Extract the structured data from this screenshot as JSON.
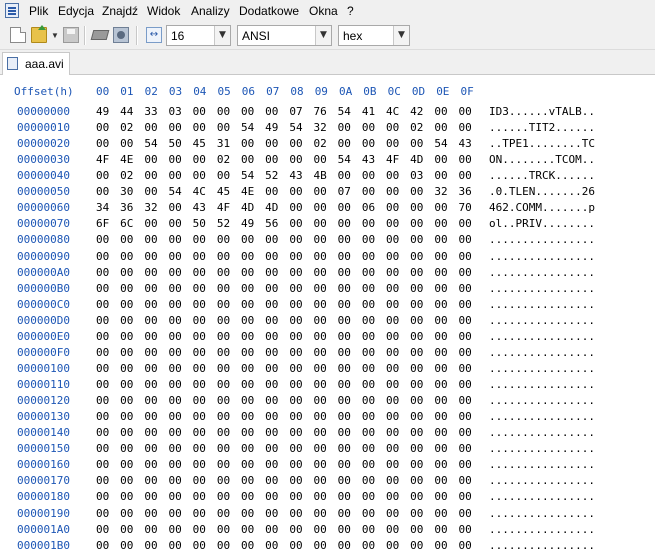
{
  "menubar": {
    "items": [
      "Plik",
      "Edycja",
      "Znajdź",
      "Widok",
      "Analizy",
      "Dodatkowe",
      "Okna",
      "?"
    ]
  },
  "toolbar": {
    "bytes_per_row": "16",
    "charset": "ANSI",
    "display_mode": "hex",
    "icons": [
      "new-file-icon",
      "open-file-icon",
      "save-icon",
      "ram-icon",
      "disk-icon",
      "width-icon"
    ]
  },
  "tab": {
    "label": "aaa.avi"
  },
  "hexview": {
    "offset_header": "Offset(h)",
    "column_headers": [
      "00",
      "01",
      "02",
      "03",
      "04",
      "05",
      "06",
      "07",
      "08",
      "09",
      "0A",
      "0B",
      "0C",
      "0D",
      "0E",
      "0F"
    ],
    "rows": [
      {
        "offset": "00000000",
        "bytes": "49 44 33 03 00 00 00 00 07 76 54 41 4C 42 00 00",
        "ascii": "ID3......vTALB.."
      },
      {
        "offset": "00000010",
        "bytes": "00 02 00 00 00 00 54 49 54 32 00 00 00 02 00 00",
        "ascii": "......TIT2......"
      },
      {
        "offset": "00000020",
        "bytes": "00 00 54 50 45 31 00 00 00 02 00 00 00 00 54 43",
        "ascii": "..TPE1........TC"
      },
      {
        "offset": "00000030",
        "bytes": "4F 4E 00 00 00 02 00 00 00 00 54 43 4F 4D 00 00",
        "ascii": "ON........TCOM.."
      },
      {
        "offset": "00000040",
        "bytes": "00 02 00 00 00 00 54 52 43 4B 00 00 00 03 00 00",
        "ascii": "......TRCK......"
      },
      {
        "offset": "00000050",
        "bytes": "00 30 00 54 4C 45 4E 00 00 00 07 00 00 00 32 36",
        "ascii": ".0.TLEN.......26"
      },
      {
        "offset": "00000060",
        "bytes": "34 36 32 00 43 4F 4D 4D 00 00 00 06 00 00 00 70",
        "ascii": "462.COMM.......p"
      },
      {
        "offset": "00000070",
        "bytes": "6F 6C 00 00 50 52 49 56 00 00 00 00 00 00 00 00",
        "ascii": "ol..PRIV........"
      },
      {
        "offset": "00000080",
        "bytes": "00 00 00 00 00 00 00 00 00 00 00 00 00 00 00 00",
        "ascii": "................"
      },
      {
        "offset": "00000090",
        "bytes": "00 00 00 00 00 00 00 00 00 00 00 00 00 00 00 00",
        "ascii": "................"
      },
      {
        "offset": "000000A0",
        "bytes": "00 00 00 00 00 00 00 00 00 00 00 00 00 00 00 00",
        "ascii": "................"
      },
      {
        "offset": "000000B0",
        "bytes": "00 00 00 00 00 00 00 00 00 00 00 00 00 00 00 00",
        "ascii": "................"
      },
      {
        "offset": "000000C0",
        "bytes": "00 00 00 00 00 00 00 00 00 00 00 00 00 00 00 00",
        "ascii": "................"
      },
      {
        "offset": "000000D0",
        "bytes": "00 00 00 00 00 00 00 00 00 00 00 00 00 00 00 00",
        "ascii": "................"
      },
      {
        "offset": "000000E0",
        "bytes": "00 00 00 00 00 00 00 00 00 00 00 00 00 00 00 00",
        "ascii": "................"
      },
      {
        "offset": "000000F0",
        "bytes": "00 00 00 00 00 00 00 00 00 00 00 00 00 00 00 00",
        "ascii": "................"
      },
      {
        "offset": "00000100",
        "bytes": "00 00 00 00 00 00 00 00 00 00 00 00 00 00 00 00",
        "ascii": "................"
      },
      {
        "offset": "00000110",
        "bytes": "00 00 00 00 00 00 00 00 00 00 00 00 00 00 00 00",
        "ascii": "................"
      },
      {
        "offset": "00000120",
        "bytes": "00 00 00 00 00 00 00 00 00 00 00 00 00 00 00 00",
        "ascii": "................"
      },
      {
        "offset": "00000130",
        "bytes": "00 00 00 00 00 00 00 00 00 00 00 00 00 00 00 00",
        "ascii": "................"
      },
      {
        "offset": "00000140",
        "bytes": "00 00 00 00 00 00 00 00 00 00 00 00 00 00 00 00",
        "ascii": "................"
      },
      {
        "offset": "00000150",
        "bytes": "00 00 00 00 00 00 00 00 00 00 00 00 00 00 00 00",
        "ascii": "................"
      },
      {
        "offset": "00000160",
        "bytes": "00 00 00 00 00 00 00 00 00 00 00 00 00 00 00 00",
        "ascii": "................"
      },
      {
        "offset": "00000170",
        "bytes": "00 00 00 00 00 00 00 00 00 00 00 00 00 00 00 00",
        "ascii": "................"
      },
      {
        "offset": "00000180",
        "bytes": "00 00 00 00 00 00 00 00 00 00 00 00 00 00 00 00",
        "ascii": "................"
      },
      {
        "offset": "00000190",
        "bytes": "00 00 00 00 00 00 00 00 00 00 00 00 00 00 00 00",
        "ascii": "................"
      },
      {
        "offset": "000001A0",
        "bytes": "00 00 00 00 00 00 00 00 00 00 00 00 00 00 00 00",
        "ascii": "................"
      },
      {
        "offset": "000001B0",
        "bytes": "00 00 00 00 00 00 00 00 00 00 00 00 00 00 00 00",
        "ascii": "................"
      }
    ]
  },
  "colors": {
    "offset_blue": "#1d56b5",
    "chrome": "#f0f0f0"
  }
}
